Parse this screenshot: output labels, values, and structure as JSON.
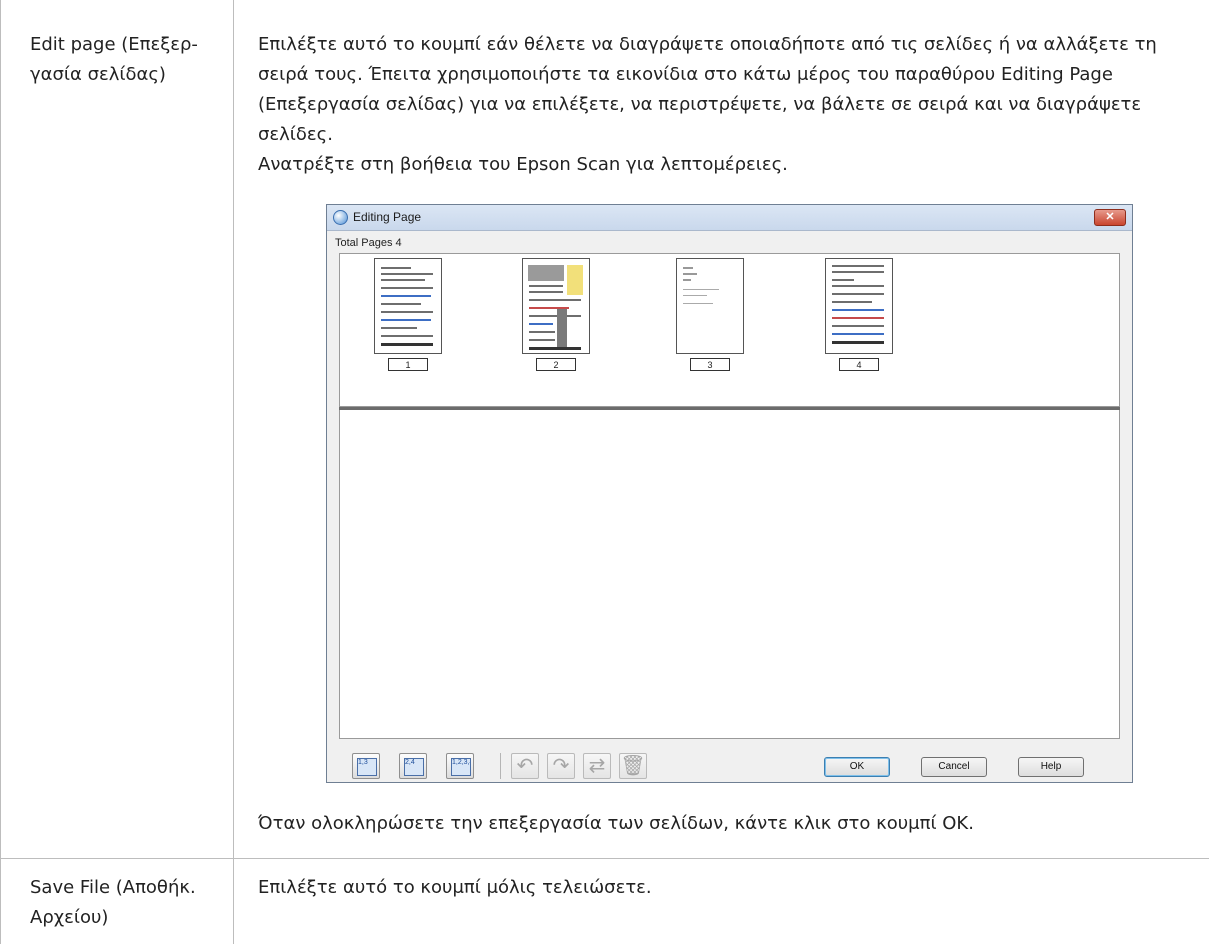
{
  "rows": [
    {
      "label": "Edit page (Επεξερ-\nγασία σελίδας)",
      "label_lines": [
        "Edit page (Επεξερ-",
        "γασία σελίδας)"
      ],
      "description_lines": [
        "Επιλέξτε αυτό το κουμπί εάν θέλετε να διαγράψετε οποιαδήποτε από τις σελίδες ή να αλλάξετε τη",
        "σειρά τους. Έπειτα χρησιμοποιήστε τα εικονίδια στο κάτω μέρος του παραθύρου Editing Page",
        "(Επεξεργασία σελίδας) για να επιλέξετε, να περιστρέψετε, να βάλετε σε σειρά και να διαγράψετε",
        "σελίδες."
      ],
      "help_line": "Ανατρέξτε στη βοήθεια του Epson Scan για λεπτομέρειες.",
      "after_text": "Όταν ολοκληρώσετε την επεξεργασία των σελίδων, κάντε κλικ στο κουμπί OK."
    },
    {
      "label_lines": [
        "Save File (Αποθήκ.",
        "Αρχείου)"
      ],
      "description": "Επιλέξτε αυτό το κουμπί μόλις τελειώσετε."
    }
  ],
  "dialog": {
    "title": "Editing Page",
    "total_pages_label": "Total Pages 4",
    "pages": [
      "1",
      "2",
      "3",
      "4"
    ],
    "toolbar_icons": [
      "select-odd-pages-icon",
      "select-even-pages-icon",
      "select-all-pages-icon",
      "rotate-left-icon",
      "rotate-right-icon",
      "reorder-icon",
      "delete-icon"
    ],
    "buttons": {
      "ok": "OK",
      "cancel": "Cancel",
      "help": "Help"
    },
    "icon_labels": {
      "odd": "1,3",
      "even": "2,4",
      "all": "1,2,3,4"
    }
  }
}
